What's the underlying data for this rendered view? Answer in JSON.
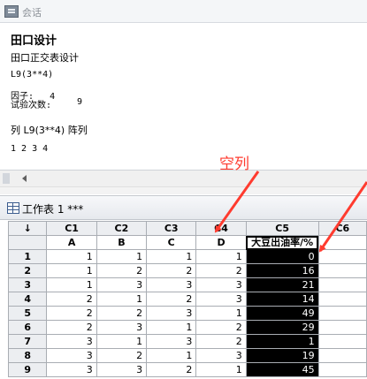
{
  "session": {
    "title": "会话",
    "heading": "田口设计",
    "subheading": "田口正交表设计",
    "design_line": "L9(3**4)",
    "factors_label": "因子:",
    "factors_value": "4",
    "runs_label": "试验次数:",
    "runs_value": "9",
    "columns_line": "列 L9(3**4) 阵列",
    "columns_values": "1 2 3 4"
  },
  "annotation": {
    "text": "空列",
    "color": "#ff3b2f"
  },
  "worksheet": {
    "title": "工作表 1 ***",
    "corner_symbol": "↓",
    "column_ids": [
      "C1",
      "C2",
      "C3",
      "C4",
      "C5",
      "C6"
    ],
    "column_names": [
      "A",
      "B",
      "C",
      "D",
      "大豆出油率/%",
      ""
    ],
    "rows": [
      {
        "n": "1",
        "cells": [
          "1",
          "1",
          "1",
          "1",
          "0"
        ]
      },
      {
        "n": "2",
        "cells": [
          "1",
          "2",
          "2",
          "2",
          "16"
        ]
      },
      {
        "n": "3",
        "cells": [
          "1",
          "3",
          "3",
          "3",
          "21"
        ]
      },
      {
        "n": "4",
        "cells": [
          "2",
          "1",
          "2",
          "3",
          "14"
        ]
      },
      {
        "n": "5",
        "cells": [
          "2",
          "2",
          "3",
          "1",
          "49"
        ]
      },
      {
        "n": "6",
        "cells": [
          "2",
          "3",
          "1",
          "2",
          "29"
        ]
      },
      {
        "n": "7",
        "cells": [
          "3",
          "1",
          "3",
          "2",
          "1"
        ]
      },
      {
        "n": "8",
        "cells": [
          "3",
          "2",
          "1",
          "3",
          "19"
        ]
      },
      {
        "n": "9",
        "cells": [
          "3",
          "3",
          "2",
          "1",
          "45"
        ]
      }
    ]
  }
}
